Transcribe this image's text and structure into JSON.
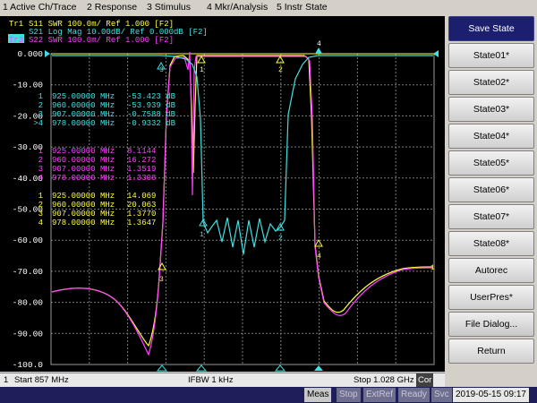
{
  "menu": [
    "1 Active Ch/Trace",
    "2 Response",
    "3 Stimulus",
    "4 Mkr/Analysis",
    "5 Instr State"
  ],
  "traces": [
    {
      "label": "Tr1",
      "text": "S11  SWR 100.0m/ Ref 1.000 [F2]",
      "color": "#ffff40"
    },
    {
      "label": "Tr2",
      "text": "S21  Log Mag 10.00dB/ Ref 0.000dB [F2]",
      "color": "#40e0e0",
      "active": true
    },
    {
      "label": "Tr3",
      "text": "S22  SWR 100.0m/ Ref 1.000 [F2]",
      "color": "#ff40ff"
    }
  ],
  "y_ticks": [
    "0.000",
    "-10.00",
    "-20.00",
    "-30.00",
    "-40.00",
    "-50.00",
    "-60.00",
    "-70.00",
    "-80.00",
    "-90.00",
    "-100.0"
  ],
  "marker_tables": [
    {
      "color": "#40e0e0",
      "rows": [
        {
          "id": "1",
          "freq": "925.00000 MHz",
          "value": "-53.423 dB"
        },
        {
          "id": "2",
          "freq": "960.00000 MHz",
          "value": "-53.939 dB"
        },
        {
          "id": "3",
          "freq": "907.00000 MHz",
          "value": "-0.7588 dB"
        },
        {
          "id": ">4",
          "freq": "978.00000 MHz",
          "value": "-0.9332 dB"
        }
      ]
    },
    {
      "color": "#ff40ff",
      "rows": [
        {
          "id": "1",
          "freq": "925.00000 MHz",
          "value": "8.1144"
        },
        {
          "id": "2",
          "freq": "960.00000 MHz",
          "value": "16.272"
        },
        {
          "id": "3",
          "freq": "907.00000 MHz",
          "value": "1.3519"
        },
        {
          "id": "4",
          "freq": "978.00000 MHz",
          "value": "1.3308"
        }
      ]
    },
    {
      "color": "#ffff40",
      "rows": [
        {
          "id": "1",
          "freq": "925.00000 MHz",
          "value": "14.069"
        },
        {
          "id": "2",
          "freq": "960.00000 MHz",
          "value": "20.063"
        },
        {
          "id": "3",
          "freq": "907.00000 MHz",
          "value": "1.3770"
        },
        {
          "id": "4",
          "freq": "978.00000 MHz",
          "value": "1.3647"
        }
      ]
    }
  ],
  "softkeys": [
    "Save State",
    "State01*",
    "State02*",
    "State03*",
    "State04*",
    "State05*",
    "State06*",
    "State07*",
    "State08*",
    "Autorec",
    "UserPres*",
    "File Dialog...",
    "Return"
  ],
  "info": {
    "channel": "1",
    "start": "Start 857 MHz",
    "ifbw": "IFBW 1 kHz",
    "stop": "Stop 1.028 GHz",
    "cor": "Cor"
  },
  "status": {
    "meas": "Meas",
    "stop": "Stop",
    "extref": "ExtRef",
    "ready": "Ready",
    "svc": "Svc",
    "datetime": "2019-05-15 09:17"
  },
  "colors": {
    "s11": "#ffff40",
    "s21": "#40e0e0",
    "s22": "#ff40ff",
    "grid": "#7a7a7a"
  }
}
